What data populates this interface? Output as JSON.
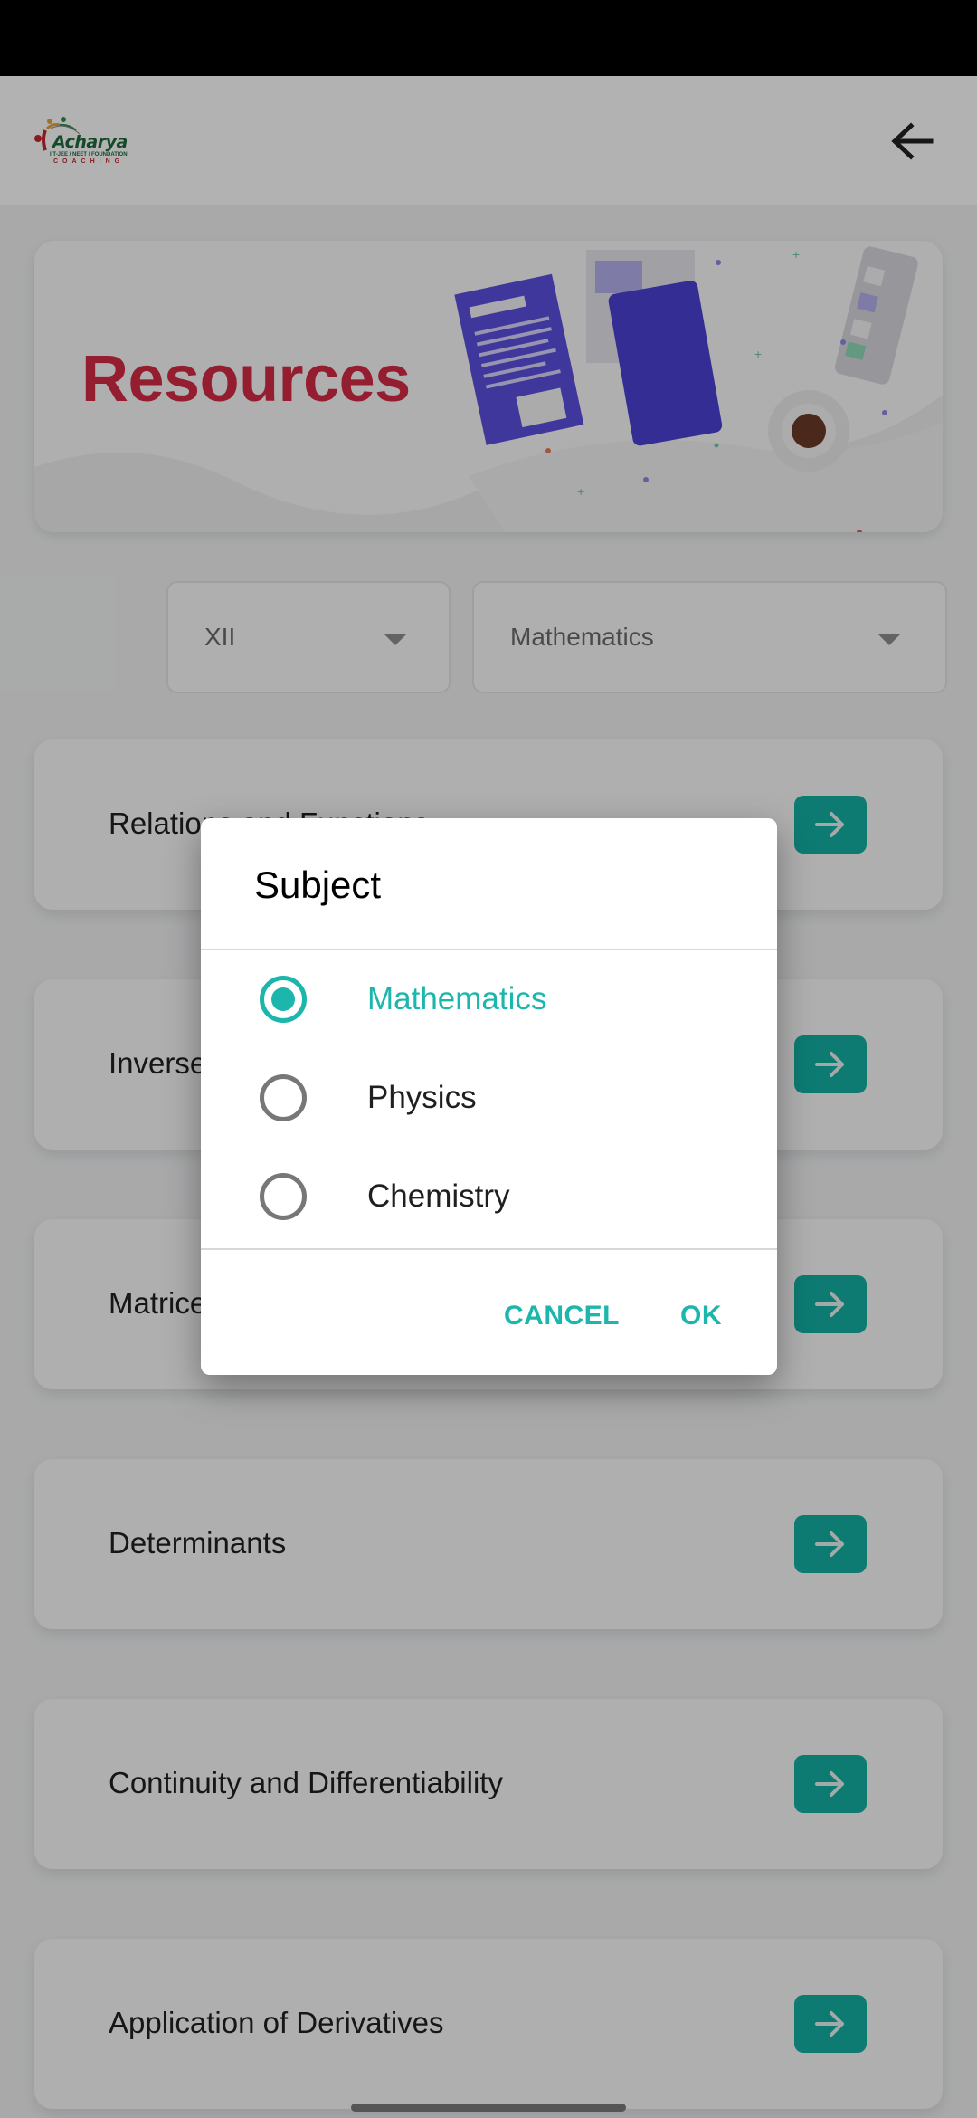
{
  "header": {
    "logo": {
      "name": "Acharya",
      "tagline": "IIT-JEE / NEET / FOUNDATION",
      "sub": "COACHING",
      "colors": {
        "green": "#1d6b3a",
        "red": "#c3272b"
      }
    },
    "back_icon": "arrow-left-icon"
  },
  "banner": {
    "title": "Resources",
    "title_color": "#d42a45",
    "illustration": "documents-and-coffee-illustration"
  },
  "filters": {
    "class_dropdown": {
      "value": "XII"
    },
    "subject_dropdown": {
      "value": "Mathematics"
    }
  },
  "topics": [
    {
      "title": "Relations and Functions",
      "action_icon": "arrow-right-icon"
    },
    {
      "title": "Inverse Trigonometric Functions",
      "action_icon": "arrow-right-icon"
    },
    {
      "title": "Matrices",
      "action_icon": "arrow-right-icon"
    },
    {
      "title": "Determinants",
      "action_icon": "arrow-right-icon"
    },
    {
      "title": "Continuity and Differentiability",
      "action_icon": "arrow-right-icon"
    },
    {
      "title": "Application of Derivatives",
      "action_icon": "arrow-right-icon"
    }
  ],
  "dialog": {
    "title": "Subject",
    "options": [
      {
        "label": "Mathematics",
        "selected": true
      },
      {
        "label": "Physics",
        "selected": false
      },
      {
        "label": "Chemistry",
        "selected": false
      }
    ],
    "cancel_label": "CANCEL",
    "ok_label": "OK"
  },
  "colors": {
    "accent": "#1cb6ac",
    "button_teal": "#14b0a4",
    "banner_purple": "#5b4fe0"
  }
}
